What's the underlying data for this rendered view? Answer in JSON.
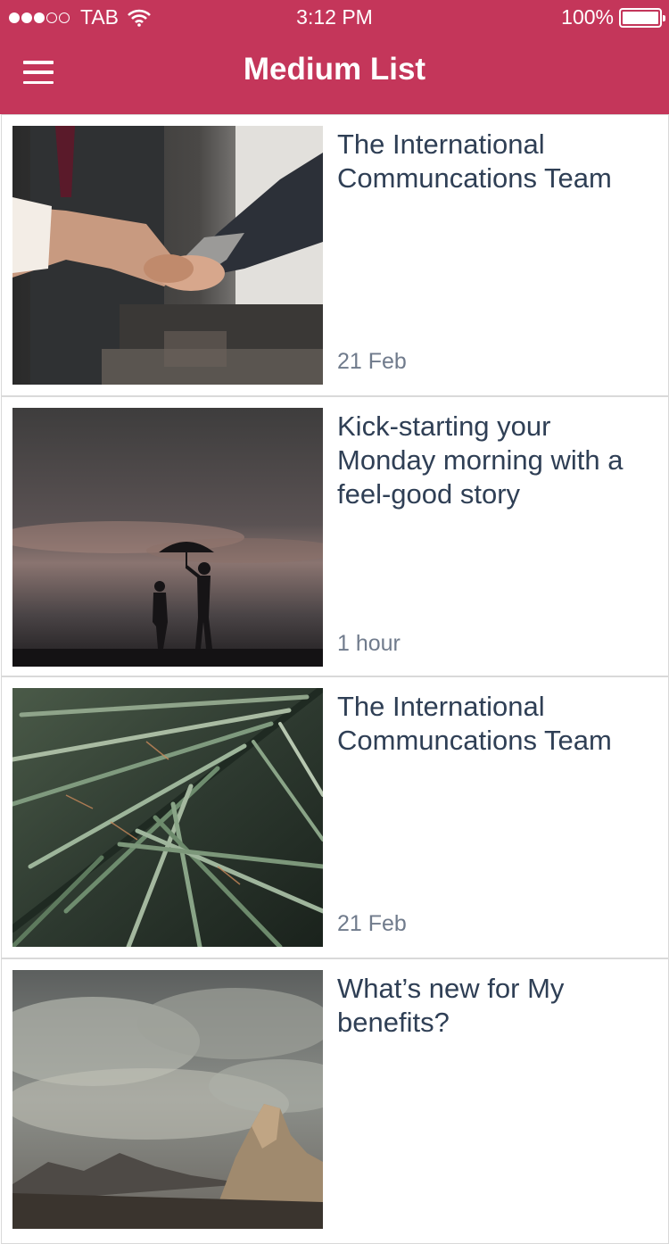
{
  "status_bar": {
    "carrier": "TAB",
    "time": "3:12 PM",
    "battery": "100%"
  },
  "header": {
    "title": "Medium List"
  },
  "colors": {
    "header_bg": "#c4365a",
    "title_text": "#2f3f55",
    "date_text": "#707b8c"
  },
  "articles": [
    {
      "title": "The International Communcations Team",
      "date": "21 Feb",
      "image": "handshake"
    },
    {
      "title": "Kick-starting your Monday morning with a feel-good story",
      "date": "1 hour",
      "image": "umbrella-silhouette"
    },
    {
      "title": "The International Communcations Team",
      "date": "21 Feb",
      "image": "palm-leaves"
    },
    {
      "title": "What’s new for My benefits?",
      "date": "",
      "image": "mountains-clouds"
    }
  ]
}
